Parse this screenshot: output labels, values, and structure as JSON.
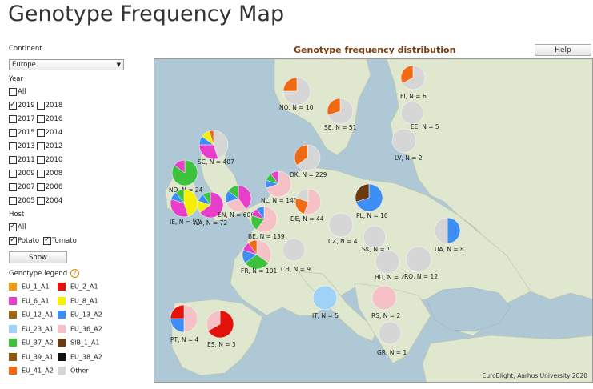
{
  "page": {
    "title": "Genotype Frequency Map"
  },
  "filters": {
    "continent_label": "Continent",
    "continent_value": "Europe",
    "year_label": "Year",
    "years_all": {
      "label": "All",
      "checked": false
    },
    "years": [
      {
        "label": "2019",
        "checked": true
      },
      {
        "label": "2018",
        "checked": false
      },
      {
        "label": "2017",
        "checked": false
      },
      {
        "label": "2016",
        "checked": false
      },
      {
        "label": "2015",
        "checked": false
      },
      {
        "label": "2014",
        "checked": false
      },
      {
        "label": "2013",
        "checked": false
      },
      {
        "label": "2012",
        "checked": false
      },
      {
        "label": "2011",
        "checked": false
      },
      {
        "label": "2010",
        "checked": false
      },
      {
        "label": "2009",
        "checked": false
      },
      {
        "label": "2008",
        "checked": false
      },
      {
        "label": "2007",
        "checked": false
      },
      {
        "label": "2006",
        "checked": false
      },
      {
        "label": "2005",
        "checked": false
      },
      {
        "label": "2004",
        "checked": false
      }
    ],
    "host_label": "Host",
    "host_all": {
      "label": "All",
      "checked": true
    },
    "hosts": [
      {
        "label": "Potato",
        "checked": true
      },
      {
        "label": "Tomato",
        "checked": true
      }
    ],
    "show_label": "Show"
  },
  "legend": {
    "title": "Genotype legend",
    "help_glyph": "?",
    "items": [
      {
        "label": "EU_1_A1",
        "color": "#f39c12"
      },
      {
        "label": "EU_2_A1",
        "color": "#e3120b"
      },
      {
        "label": "EU_6_A1",
        "color": "#e83fcb"
      },
      {
        "label": "EU_8_A1",
        "color": "#f5f000"
      },
      {
        "label": "EU_12_A1",
        "color": "#9c6a12"
      },
      {
        "label": "EU_13_A2",
        "color": "#3d8ef5"
      },
      {
        "label": "EU_23_A1",
        "color": "#9fd2f7"
      },
      {
        "label": "EU_36_A2",
        "color": "#f6c1c6"
      },
      {
        "label": "EU_37_A2",
        "color": "#3cc23c"
      },
      {
        "label": "SIB_1_A1",
        "color": "#6b3a10"
      },
      {
        "label": "EU_39_A1",
        "color": "#8a5a0a"
      },
      {
        "label": "EU_38_A2",
        "color": "#111111"
      },
      {
        "label": "EU_41_A2",
        "color": "#f06a14"
      },
      {
        "label": "Other",
        "color": "#d6d6d6"
      }
    ]
  },
  "chart": {
    "title": "Genotype frequency distribution",
    "help_label": "Help",
    "credit": "EuroBlight, Aarhus University 2020",
    "countries": [
      {
        "label": "NO, N = 10",
        "slices": [
          [
            "Other",
            0.75
          ],
          [
            "EU_41_A2",
            0.25
          ]
        ]
      },
      {
        "label": "FI, N = 6",
        "slices": [
          [
            "Other",
            0.67
          ],
          [
            "EU_41_A2",
            0.33
          ]
        ]
      },
      {
        "label": "SE, N = 51",
        "slices": [
          [
            "Other",
            0.7
          ],
          [
            "EU_41_A2",
            0.3
          ]
        ]
      },
      {
        "label": "EE, N = 5",
        "slices": [
          [
            "Other",
            1.0
          ]
        ]
      },
      {
        "label": "LV, N = 2",
        "slices": [
          [
            "Other",
            1.0
          ]
        ]
      },
      {
        "label": "SC, N = 407",
        "slices": [
          [
            "Other",
            0.45
          ],
          [
            "EU_6_A1",
            0.3
          ],
          [
            "EU_13_A2",
            0.1
          ],
          [
            "EU_8_A1",
            0.1
          ],
          [
            "EU_41_A2",
            0.05
          ]
        ]
      },
      {
        "label": "DK, N = 229",
        "slices": [
          [
            "Other",
            0.65
          ],
          [
            "EU_41_A2",
            0.35
          ]
        ]
      },
      {
        "label": "ND, N = 24",
        "slices": [
          [
            "EU_37_A2",
            0.85
          ],
          [
            "EU_6_A1",
            0.15
          ]
        ]
      },
      {
        "label": "NL, N = 143",
        "slices": [
          [
            "EU_36_A2",
            0.7
          ],
          [
            "EU_13_A2",
            0.1
          ],
          [
            "EU_37_A2",
            0.1
          ],
          [
            "EU_6_A1",
            0.1
          ]
        ]
      },
      {
        "label": "IE, N = 17",
        "slices": [
          [
            "EU_8_A1",
            0.45
          ],
          [
            "EU_6_A1",
            0.35
          ],
          [
            "EU_13_A2",
            0.1
          ],
          [
            "EU_37_A2",
            0.1
          ]
        ]
      },
      {
        "label": "WA, N = 72",
        "slices": [
          [
            "EU_6_A1",
            0.65
          ],
          [
            "EU_8_A1",
            0.15
          ],
          [
            "EU_13_A2",
            0.1
          ],
          [
            "EU_37_A2",
            0.1
          ]
        ]
      },
      {
        "label": "EN, N = 606",
        "slices": [
          [
            "EU_6_A1",
            0.4
          ],
          [
            "EU_36_A2",
            0.3
          ],
          [
            "EU_13_A2",
            0.15
          ],
          [
            "EU_37_A2",
            0.15
          ]
        ]
      },
      {
        "label": "DE, N = 44",
        "slices": [
          [
            "EU_36_A2",
            0.55
          ],
          [
            "EU_41_A2",
            0.25
          ],
          [
            "Other",
            0.2
          ]
        ]
      },
      {
        "label": "PL, N = 10",
        "slices": [
          [
            "EU_13_A2",
            0.7
          ],
          [
            "SIB_1_A1",
            0.3
          ]
        ]
      },
      {
        "label": "BE, N = 139",
        "slices": [
          [
            "EU_36_A2",
            0.6
          ],
          [
            "EU_37_A2",
            0.2
          ],
          [
            "EU_6_A1",
            0.1
          ],
          [
            "EU_13_A2",
            0.1
          ]
        ]
      },
      {
        "label": "CZ, N = 4",
        "slices": [
          [
            "Other",
            1.0
          ]
        ]
      },
      {
        "label": "SK, N = 1",
        "slices": [
          [
            "Other",
            1.0
          ]
        ]
      },
      {
        "label": "UA, N = 8",
        "slices": [
          [
            "EU_13_A2",
            0.5
          ],
          [
            "Other",
            0.5
          ]
        ]
      },
      {
        "label": "CH, N = 9",
        "slices": [
          [
            "Other",
            1.0
          ]
        ]
      },
      {
        "label": "FR, N = 101",
        "slices": [
          [
            "EU_36_A2",
            0.35
          ],
          [
            "EU_37_A2",
            0.3
          ],
          [
            "EU_13_A2",
            0.15
          ],
          [
            "EU_6_A1",
            0.1
          ],
          [
            "EU_41_A2",
            0.1
          ]
        ]
      },
      {
        "label": "HU, N = 2",
        "slices": [
          [
            "Other",
            1.0
          ]
        ]
      },
      {
        "label": "RO, N = 12",
        "slices": [
          [
            "Other",
            1.0
          ]
        ]
      },
      {
        "label": "IT, N = 5",
        "slices": [
          [
            "EU_23_A1",
            1.0
          ]
        ]
      },
      {
        "label": "RS, N = 2",
        "slices": [
          [
            "EU_36_A2",
            1.0
          ]
        ]
      },
      {
        "label": "PT, N = 4",
        "slices": [
          [
            "EU_36_A2",
            0.5
          ],
          [
            "EU_13_A2",
            0.25
          ],
          [
            "EU_2_A1",
            0.25
          ]
        ]
      },
      {
        "label": "ES, N = 3",
        "slices": [
          [
            "EU_2_A1",
            0.67
          ],
          [
            "EU_36_A2",
            0.33
          ]
        ]
      },
      {
        "label": "GR, N = 1",
        "slices": [
          [
            "Other",
            1.0
          ]
        ]
      }
    ]
  }
}
